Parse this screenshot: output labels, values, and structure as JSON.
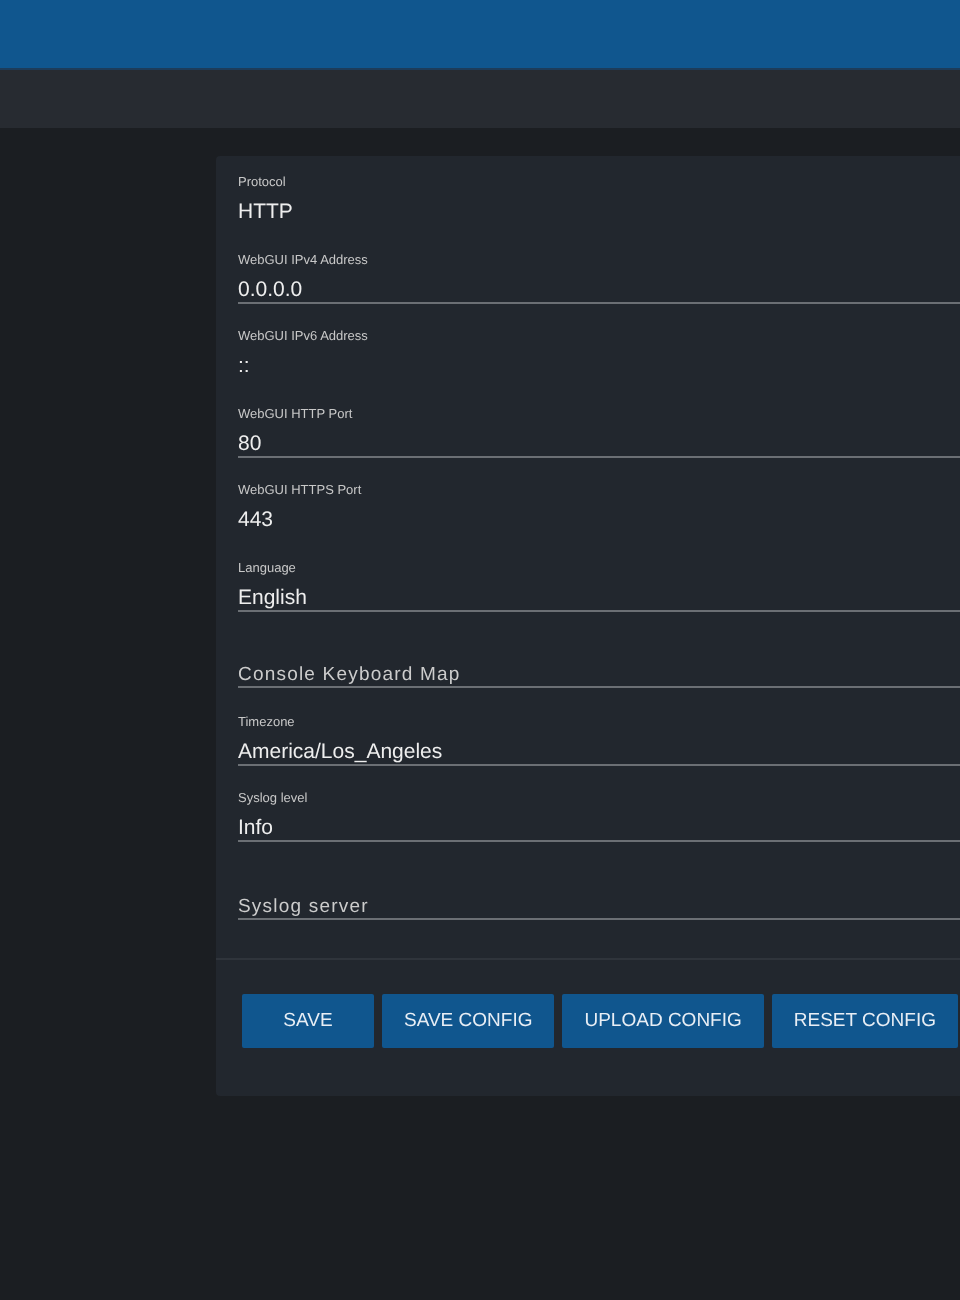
{
  "fields": [
    {
      "label": "Protocol",
      "value": "HTTP",
      "kind": "plain"
    },
    {
      "label": "WebGUI IPv4 Address",
      "value": "0.0.0.0",
      "kind": "input"
    },
    {
      "label": "WebGUI IPv6 Address",
      "value": "::",
      "kind": "plain"
    },
    {
      "label": "WebGUI HTTP Port",
      "value": "80",
      "kind": "input"
    },
    {
      "label": "WebGUI HTTPS Port",
      "value": "443",
      "kind": "plain"
    },
    {
      "label": "Language",
      "value": "English",
      "kind": "input"
    },
    {
      "placeholder": "Console Keyboard Map",
      "kind": "input"
    },
    {
      "label": "Timezone",
      "value": "America/Los_Angeles",
      "kind": "input"
    },
    {
      "label": "Syslog level",
      "value": "Info",
      "kind": "input"
    },
    {
      "placeholder": "Syslog server",
      "kind": "input"
    }
  ],
  "buttons": [
    "SAVE",
    "SAVE CONFIG",
    "UPLOAD CONFIG",
    "RESET CONFIG"
  ]
}
